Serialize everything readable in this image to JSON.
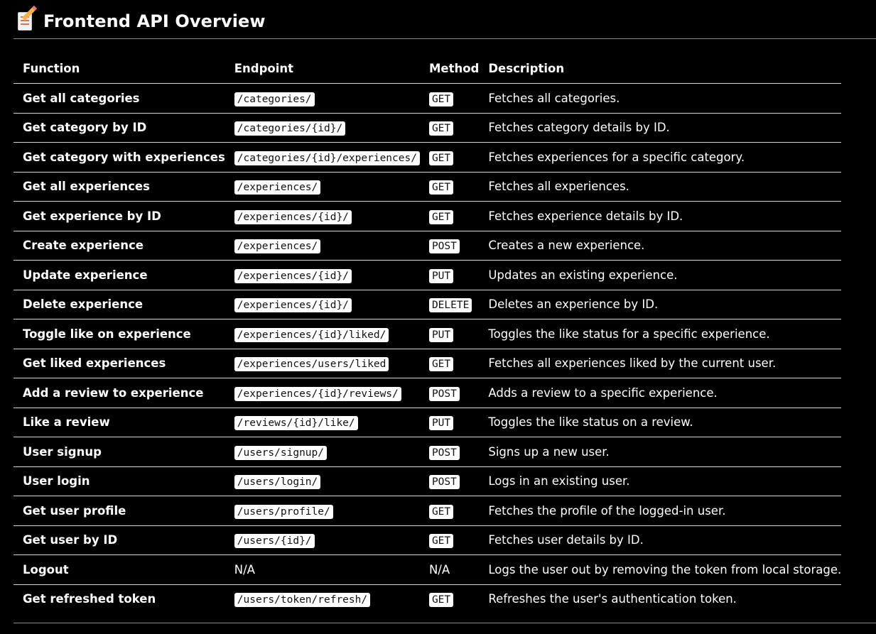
{
  "page": {
    "title": "Frontend API Overview",
    "icon": "memo-icon"
  },
  "table": {
    "headers": [
      "Function",
      "Endpoint",
      "Method",
      "Description"
    ],
    "rows": [
      {
        "function": "Get all categories",
        "endpoint": "/categories/",
        "method": "GET",
        "description": "Fetches all categories."
      },
      {
        "function": "Get category by ID",
        "endpoint": "/categories/{id}/",
        "method": "GET",
        "description": "Fetches category details by ID."
      },
      {
        "function": "Get category with experiences",
        "endpoint": "/categories/{id}/experiences/",
        "method": "GET",
        "description": "Fetches experiences for a specific category."
      },
      {
        "function": "Get all experiences",
        "endpoint": "/experiences/",
        "method": "GET",
        "description": "Fetches all experiences."
      },
      {
        "function": "Get experience by ID",
        "endpoint": "/experiences/{id}/",
        "method": "GET",
        "description": "Fetches experience details by ID."
      },
      {
        "function": "Create experience",
        "endpoint": "/experiences/",
        "method": "POST",
        "description": "Creates a new experience."
      },
      {
        "function": "Update experience",
        "endpoint": "/experiences/{id}/",
        "method": "PUT",
        "description": "Updates an existing experience."
      },
      {
        "function": "Delete experience",
        "endpoint": "/experiences/{id}/",
        "method": "DELETE",
        "description": "Deletes an experience by ID."
      },
      {
        "function": "Toggle like on experience",
        "endpoint": "/experiences/{id}/liked/",
        "method": "PUT",
        "description": "Toggles the like status for a specific experience."
      },
      {
        "function": "Get liked experiences",
        "endpoint": "/experiences/users/liked",
        "method": "GET",
        "description": "Fetches all experiences liked by the current user."
      },
      {
        "function": "Add a review to experience",
        "endpoint": "/experiences/{id}/reviews/",
        "method": "POST",
        "description": "Adds a review to a specific experience."
      },
      {
        "function": "Like a review",
        "endpoint": "/reviews/{id}/like/",
        "method": "PUT",
        "description": "Toggles the like status on a review."
      },
      {
        "function": "User signup",
        "endpoint": "/users/signup/",
        "method": "POST",
        "description": "Signs up a new user."
      },
      {
        "function": "User login",
        "endpoint": "/users/login/",
        "method": "POST",
        "description": "Logs in an existing user."
      },
      {
        "function": "Get user profile",
        "endpoint": "/users/profile/",
        "method": "GET",
        "description": "Fetches the profile of the logged-in user."
      },
      {
        "function": "Get user by ID",
        "endpoint": "/users/{id}/",
        "method": "GET",
        "description": "Fetches user details by ID."
      },
      {
        "function": "Logout",
        "endpoint": "N/A",
        "method": "N/A",
        "description": "Logs the user out by removing the token from local storage.",
        "plain": true
      },
      {
        "function": "Get refreshed token",
        "endpoint": "/users/token/refresh/",
        "method": "GET",
        "description": "Refreshes the user's authentication token."
      }
    ]
  }
}
